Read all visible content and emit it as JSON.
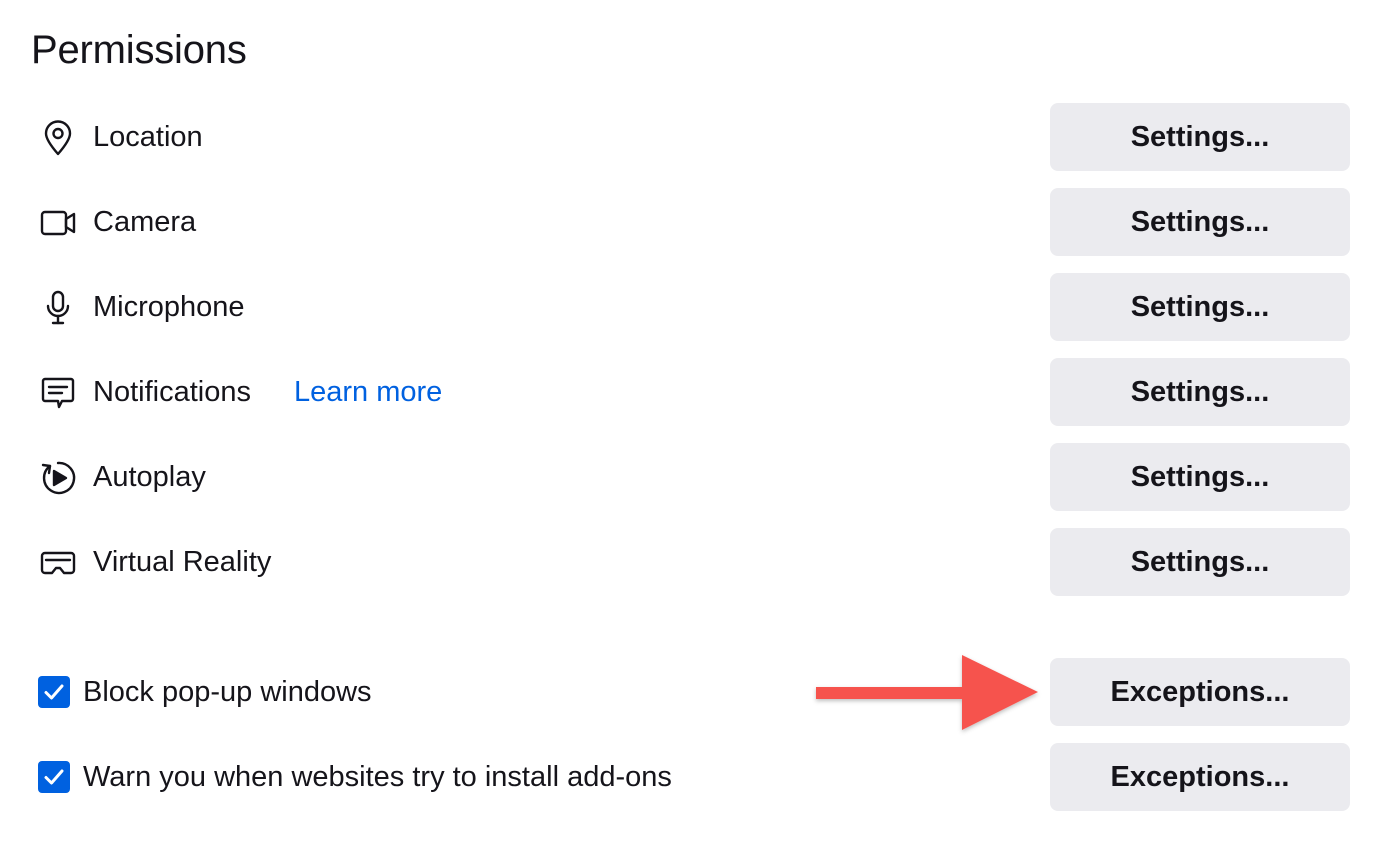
{
  "section": {
    "title": "Permissions"
  },
  "permissions": [
    {
      "id": "location",
      "label": "Location",
      "icon": "location-pin-icon",
      "button": "Settings..."
    },
    {
      "id": "camera",
      "label": "Camera",
      "icon": "camera-icon",
      "button": "Settings..."
    },
    {
      "id": "microphone",
      "label": "Microphone",
      "icon": "microphone-icon",
      "button": "Settings..."
    },
    {
      "id": "notifications",
      "label": "Notifications",
      "link": "Learn more",
      "icon": "notification-bubble-icon",
      "button": "Settings..."
    },
    {
      "id": "autoplay",
      "label": "Autoplay",
      "icon": "autoplay-icon",
      "button": "Settings..."
    },
    {
      "id": "virtual-reality",
      "label": "Virtual Reality",
      "icon": "vr-headset-icon",
      "button": "Settings..."
    }
  ],
  "options": [
    {
      "id": "block-popups",
      "label": "Block pop-up windows",
      "checked": true,
      "button": "Exceptions..."
    },
    {
      "id": "warn-addons",
      "label": "Warn you when websites try to install add-ons",
      "checked": true,
      "button": "Exceptions..."
    }
  ],
  "colors": {
    "accent": "#0061e0",
    "button_bg": "#ebebef",
    "annotation_arrow": "#f6534d"
  }
}
